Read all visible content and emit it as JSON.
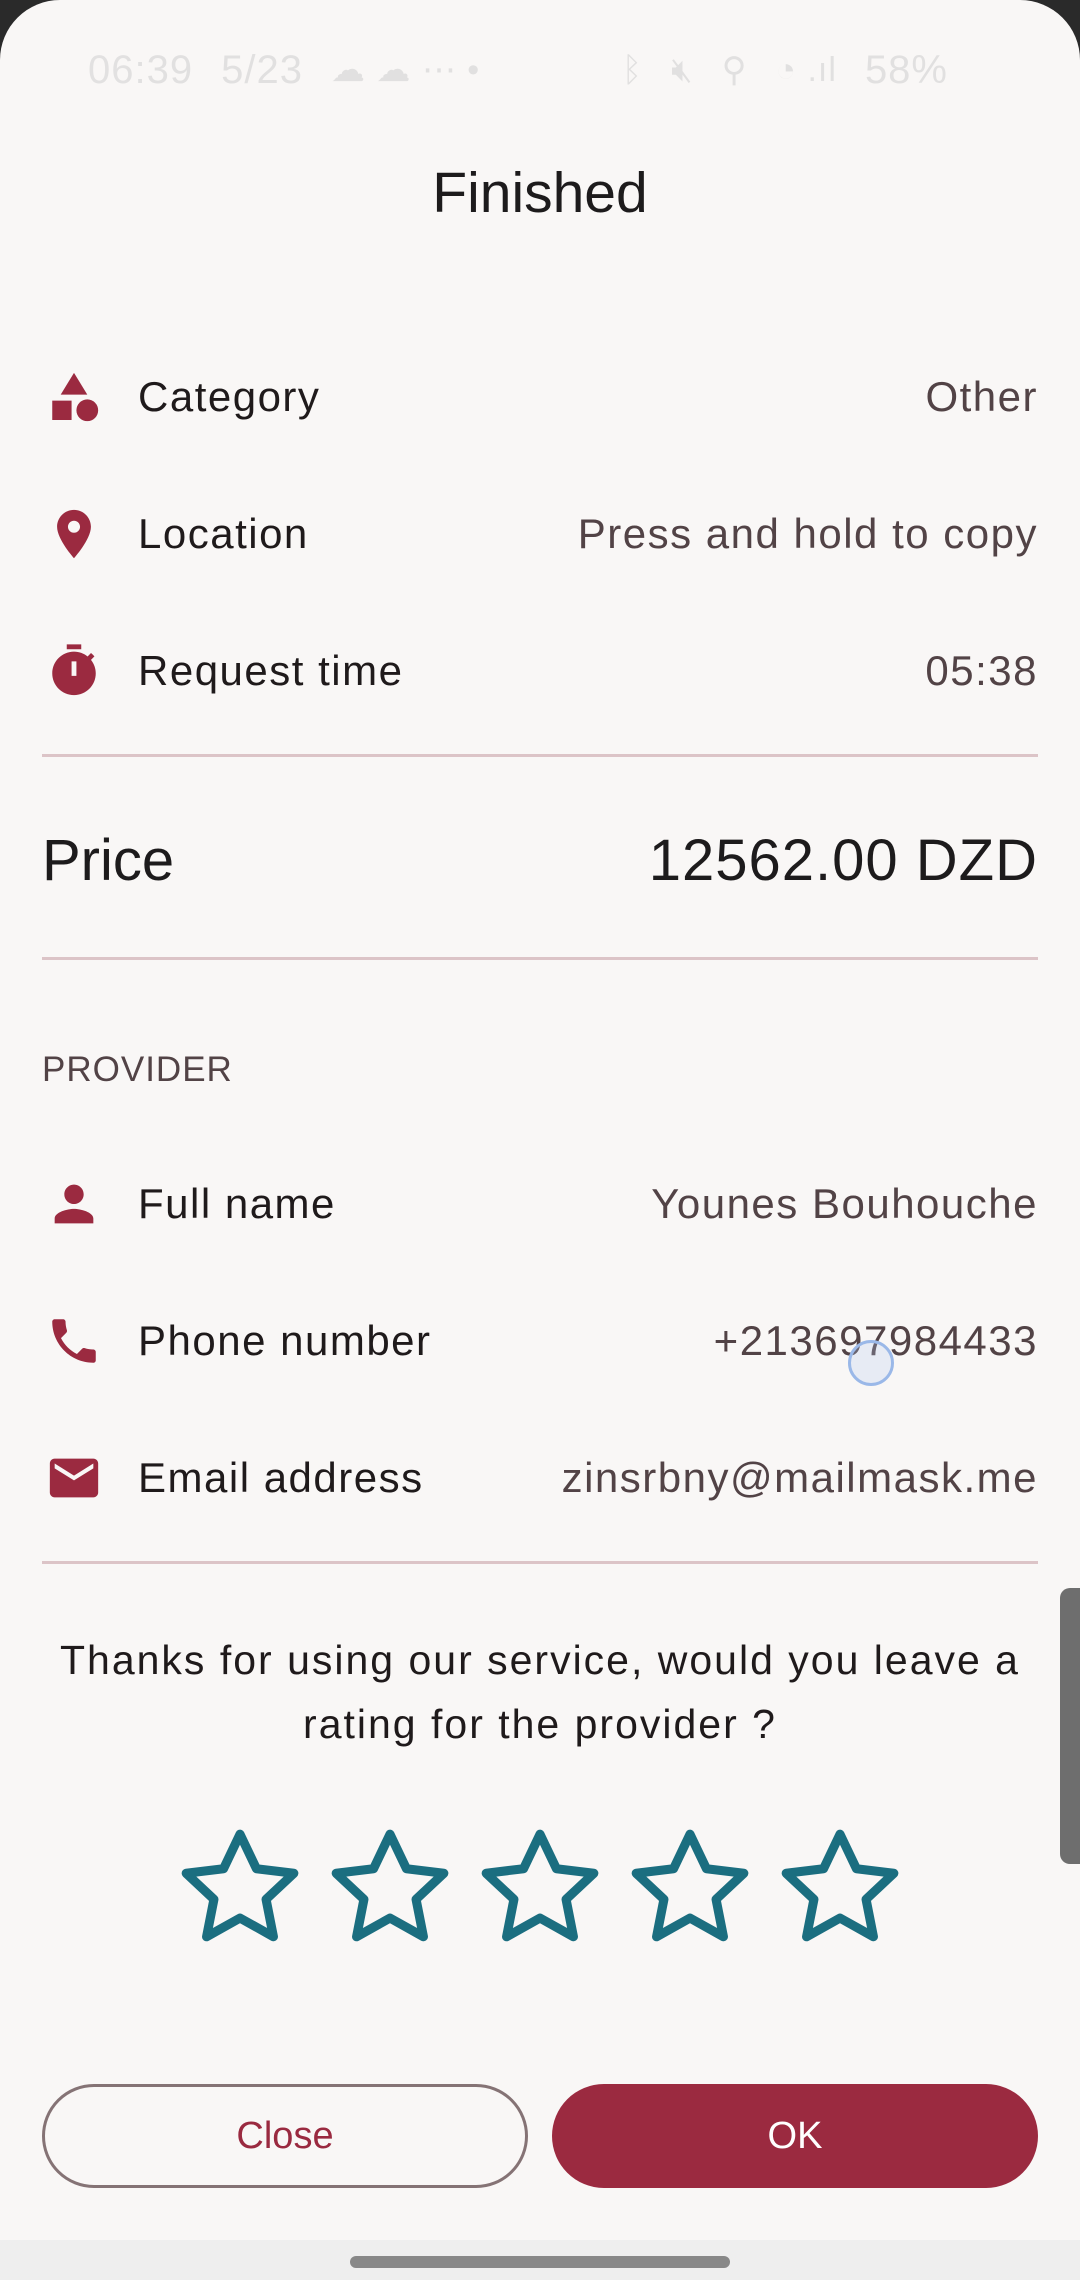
{
  "status_bar": {
    "time": "06:39",
    "date": "5/23",
    "battery": "58%"
  },
  "dialog": {
    "title": "Finished",
    "request_rows": [
      {
        "icon": "category-shapes-icon",
        "label": "Category",
        "value": "Other"
      },
      {
        "icon": "location-pin-icon",
        "label": "Location",
        "value": "Press and hold to copy"
      },
      {
        "icon": "timer-icon",
        "label": "Request time",
        "value": "05:38"
      }
    ],
    "price": {
      "label": "Price",
      "value": "12562.00 DZD"
    },
    "provider_section": {
      "header": "PROVIDER",
      "rows": [
        {
          "icon": "person-icon",
          "label": "Full name",
          "value": "Younes Bouhouche"
        },
        {
          "icon": "phone-icon",
          "label": "Phone number",
          "value": "+213697984433"
        },
        {
          "icon": "email-icon",
          "label": "Email address",
          "value": "zinsrbny@mailmask.me"
        }
      ]
    },
    "rating_prompt": "Thanks for using our service, would you leave a rating for the provider ?",
    "rating": {
      "max": 5,
      "selected": 0
    },
    "buttons": {
      "close_label": "Close",
      "ok_label": "OK"
    }
  },
  "colors": {
    "primary": "#9b2a40",
    "star_outline": "#1b6e80",
    "background": "#f9f7f6",
    "divider": "#dcc4c7",
    "secondary_text": "#524346"
  }
}
